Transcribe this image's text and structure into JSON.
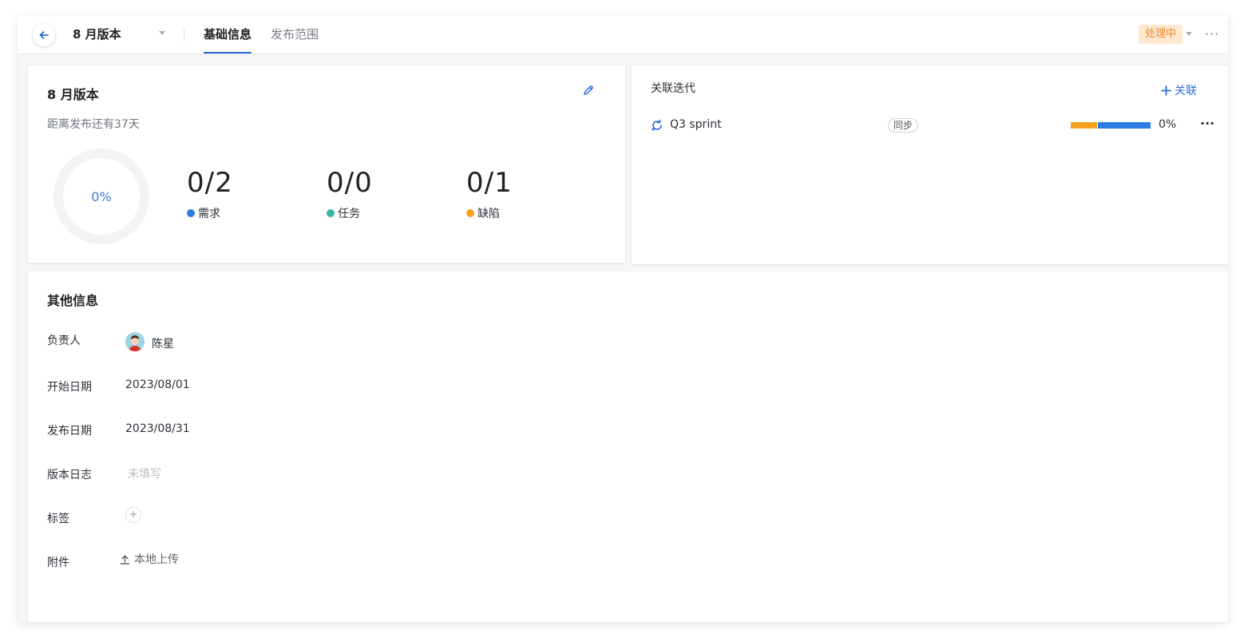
{
  "header": {
    "title": "8 月版本",
    "tabs": [
      {
        "label": "基础信息",
        "active": true
      },
      {
        "label": "发布范围",
        "active": false
      }
    ],
    "status": "处理中",
    "more": "···"
  },
  "overview": {
    "title": "8 月版本",
    "countdown": "距离发布还有37天",
    "progress_percent": "0%",
    "stats": [
      {
        "value": "0/2",
        "label": "需求",
        "color": "#2e7be3"
      },
      {
        "value": "0/0",
        "label": "任务",
        "color": "#3bb5a8"
      },
      {
        "value": "0/1",
        "label": "缺陷",
        "color": "#f6a21e"
      }
    ]
  },
  "iterations": {
    "title": "关联迭代",
    "link_label": "关联",
    "items": [
      {
        "name": "Q3 sprint",
        "tag": "同步",
        "progress_text": "0%",
        "segments": [
          {
            "fraction": 0.33,
            "color": "#f6a21e"
          },
          {
            "fraction": 0.66,
            "color": "#2e7be3"
          }
        ]
      }
    ]
  },
  "other_info": {
    "title": "其他信息",
    "owner": {
      "label": "负责人",
      "name": "陈星"
    },
    "start_date": {
      "label": "开始日期",
      "value": "2023/08/01"
    },
    "release_date": {
      "label": "发布日期",
      "value": "2023/08/31"
    },
    "release_log": {
      "label": "版本日志",
      "placeholder": "未填写"
    },
    "tags": {
      "label": "标签",
      "add": "+"
    },
    "attachments": {
      "label": "附件",
      "upload_label": "本地上传"
    }
  },
  "colors": {
    "accent": "#2e6bd8",
    "status_bg": "#fde8cf",
    "status_text": "#f08a24"
  }
}
